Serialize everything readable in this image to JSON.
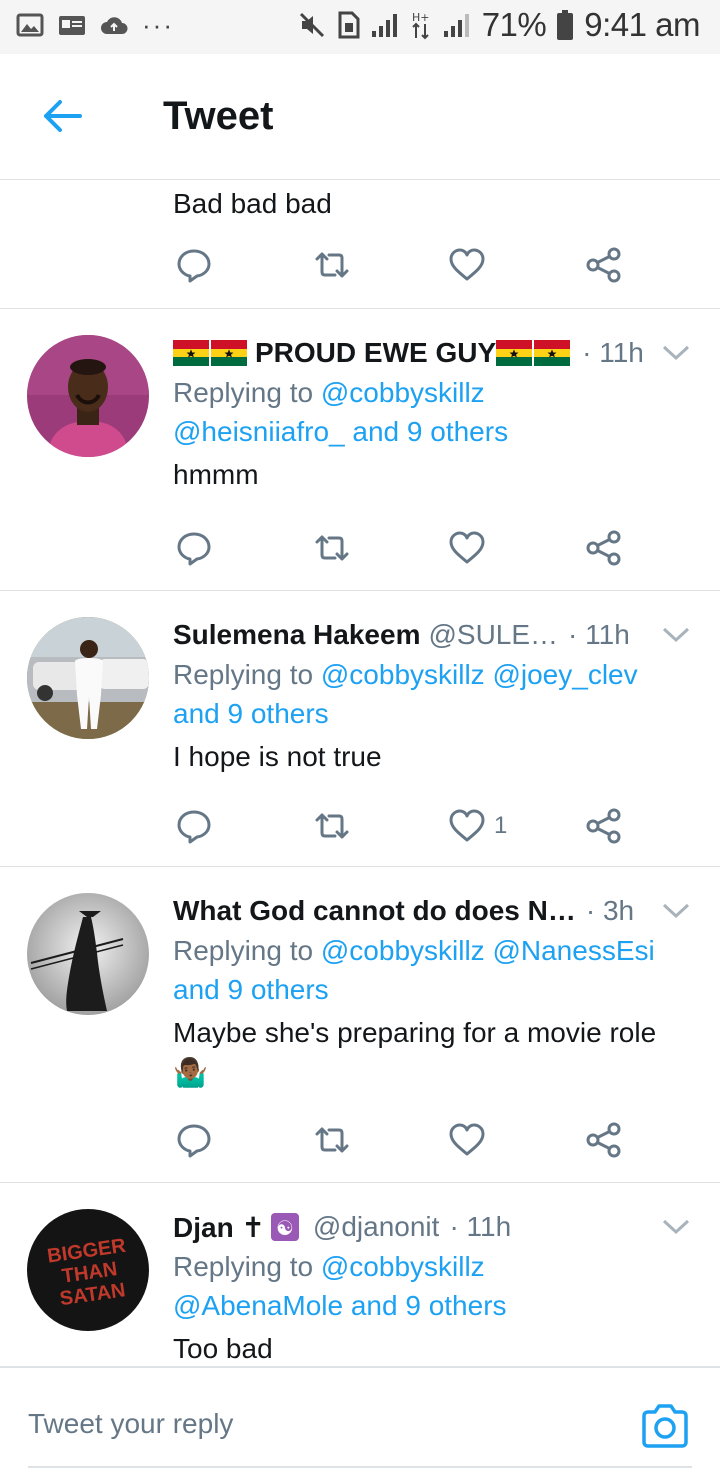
{
  "status_bar": {
    "battery": "71%",
    "time": "9:41 am",
    "network": "H+"
  },
  "header": {
    "title": "Tweet"
  },
  "tweets": [
    {
      "body": "Bad bad bad",
      "actions": {
        "like_count": ""
      }
    },
    {
      "name": "PROUD EWE GUY",
      "handle": "",
      "time": "· 11h",
      "replying_label": "Replying to",
      "mention_line1": "@cobbyskillz",
      "mention_line2": "@heisniiafro_ and 9 others",
      "body": "hmmm",
      "actions": {
        "like_count": ""
      }
    },
    {
      "name": "Sulemena Hakeem",
      "handle": "@SULE…",
      "time": "· 11h",
      "replying_label": "Replying to",
      "mention_line1": "@cobbyskillz @joey_clev",
      "mention_line2": "and 9 others",
      "body": "I hope is not true",
      "actions": {
        "like_count": "1"
      }
    },
    {
      "name": "What God cannot do does N…",
      "handle": "",
      "time": "· 3h",
      "replying_label": "Replying to",
      "mention_line1": "@cobbyskillz @NanessEsi",
      "mention_line2": "and 9 others",
      "body": "Maybe she's preparing for a movie role",
      "emoji": "🤷🏾‍♂️",
      "actions": {
        "like_count": ""
      }
    },
    {
      "name": "Djan ✝",
      "name_symbol": "☯",
      "handle": "@djanonit",
      "time": "· 11h",
      "replying_label": "Replying to",
      "mention_line1": "@cobbyskillz",
      "mention_line2": "@AbenaMole and 9 others",
      "body": "Too bad",
      "avatar_text": [
        "BIGGER",
        "THAN",
        "SATAN"
      ]
    }
  ],
  "composer": {
    "placeholder": "Tweet your reply"
  },
  "colors": {
    "accent": "#1da1f2",
    "text": "#14171a",
    "secondary": "#657786",
    "divider": "#dfe3e6"
  },
  "icons": {
    "back": "arrow-left-icon",
    "reply": "reply-icon",
    "retweet": "retweet-icon",
    "like": "heart-icon",
    "share": "share-icon",
    "caret": "chevron-down-icon",
    "camera": "camera-icon"
  }
}
